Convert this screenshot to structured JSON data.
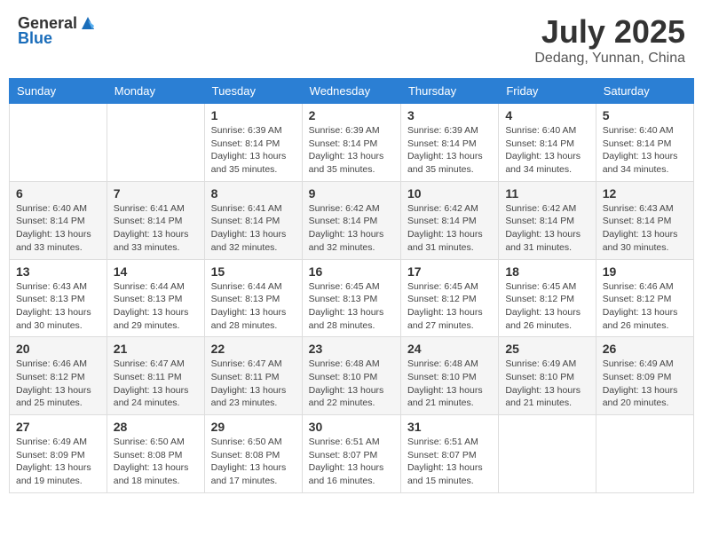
{
  "header": {
    "logo_general": "General",
    "logo_blue": "Blue",
    "month": "July 2025",
    "location": "Dedang, Yunnan, China"
  },
  "days_of_week": [
    "Sunday",
    "Monday",
    "Tuesday",
    "Wednesday",
    "Thursday",
    "Friday",
    "Saturday"
  ],
  "weeks": [
    [
      {
        "day": "",
        "info": ""
      },
      {
        "day": "",
        "info": ""
      },
      {
        "day": "1",
        "info": "Sunrise: 6:39 AM\nSunset: 8:14 PM\nDaylight: 13 hours and 35 minutes."
      },
      {
        "day": "2",
        "info": "Sunrise: 6:39 AM\nSunset: 8:14 PM\nDaylight: 13 hours and 35 minutes."
      },
      {
        "day": "3",
        "info": "Sunrise: 6:39 AM\nSunset: 8:14 PM\nDaylight: 13 hours and 35 minutes."
      },
      {
        "day": "4",
        "info": "Sunrise: 6:40 AM\nSunset: 8:14 PM\nDaylight: 13 hours and 34 minutes."
      },
      {
        "day": "5",
        "info": "Sunrise: 6:40 AM\nSunset: 8:14 PM\nDaylight: 13 hours and 34 minutes."
      }
    ],
    [
      {
        "day": "6",
        "info": "Sunrise: 6:40 AM\nSunset: 8:14 PM\nDaylight: 13 hours and 33 minutes."
      },
      {
        "day": "7",
        "info": "Sunrise: 6:41 AM\nSunset: 8:14 PM\nDaylight: 13 hours and 33 minutes."
      },
      {
        "day": "8",
        "info": "Sunrise: 6:41 AM\nSunset: 8:14 PM\nDaylight: 13 hours and 32 minutes."
      },
      {
        "day": "9",
        "info": "Sunrise: 6:42 AM\nSunset: 8:14 PM\nDaylight: 13 hours and 32 minutes."
      },
      {
        "day": "10",
        "info": "Sunrise: 6:42 AM\nSunset: 8:14 PM\nDaylight: 13 hours and 31 minutes."
      },
      {
        "day": "11",
        "info": "Sunrise: 6:42 AM\nSunset: 8:14 PM\nDaylight: 13 hours and 31 minutes."
      },
      {
        "day": "12",
        "info": "Sunrise: 6:43 AM\nSunset: 8:14 PM\nDaylight: 13 hours and 30 minutes."
      }
    ],
    [
      {
        "day": "13",
        "info": "Sunrise: 6:43 AM\nSunset: 8:13 PM\nDaylight: 13 hours and 30 minutes."
      },
      {
        "day": "14",
        "info": "Sunrise: 6:44 AM\nSunset: 8:13 PM\nDaylight: 13 hours and 29 minutes."
      },
      {
        "day": "15",
        "info": "Sunrise: 6:44 AM\nSunset: 8:13 PM\nDaylight: 13 hours and 28 minutes."
      },
      {
        "day": "16",
        "info": "Sunrise: 6:45 AM\nSunset: 8:13 PM\nDaylight: 13 hours and 28 minutes."
      },
      {
        "day": "17",
        "info": "Sunrise: 6:45 AM\nSunset: 8:12 PM\nDaylight: 13 hours and 27 minutes."
      },
      {
        "day": "18",
        "info": "Sunrise: 6:45 AM\nSunset: 8:12 PM\nDaylight: 13 hours and 26 minutes."
      },
      {
        "day": "19",
        "info": "Sunrise: 6:46 AM\nSunset: 8:12 PM\nDaylight: 13 hours and 26 minutes."
      }
    ],
    [
      {
        "day": "20",
        "info": "Sunrise: 6:46 AM\nSunset: 8:12 PM\nDaylight: 13 hours and 25 minutes."
      },
      {
        "day": "21",
        "info": "Sunrise: 6:47 AM\nSunset: 8:11 PM\nDaylight: 13 hours and 24 minutes."
      },
      {
        "day": "22",
        "info": "Sunrise: 6:47 AM\nSunset: 8:11 PM\nDaylight: 13 hours and 23 minutes."
      },
      {
        "day": "23",
        "info": "Sunrise: 6:48 AM\nSunset: 8:10 PM\nDaylight: 13 hours and 22 minutes."
      },
      {
        "day": "24",
        "info": "Sunrise: 6:48 AM\nSunset: 8:10 PM\nDaylight: 13 hours and 21 minutes."
      },
      {
        "day": "25",
        "info": "Sunrise: 6:49 AM\nSunset: 8:10 PM\nDaylight: 13 hours and 21 minutes."
      },
      {
        "day": "26",
        "info": "Sunrise: 6:49 AM\nSunset: 8:09 PM\nDaylight: 13 hours and 20 minutes."
      }
    ],
    [
      {
        "day": "27",
        "info": "Sunrise: 6:49 AM\nSunset: 8:09 PM\nDaylight: 13 hours and 19 minutes."
      },
      {
        "day": "28",
        "info": "Sunrise: 6:50 AM\nSunset: 8:08 PM\nDaylight: 13 hours and 18 minutes."
      },
      {
        "day": "29",
        "info": "Sunrise: 6:50 AM\nSunset: 8:08 PM\nDaylight: 13 hours and 17 minutes."
      },
      {
        "day": "30",
        "info": "Sunrise: 6:51 AM\nSunset: 8:07 PM\nDaylight: 13 hours and 16 minutes."
      },
      {
        "day": "31",
        "info": "Sunrise: 6:51 AM\nSunset: 8:07 PM\nDaylight: 13 hours and 15 minutes."
      },
      {
        "day": "",
        "info": ""
      },
      {
        "day": "",
        "info": ""
      }
    ]
  ]
}
